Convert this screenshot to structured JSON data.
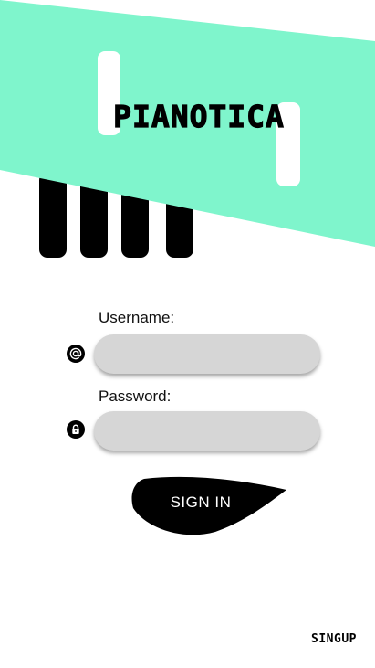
{
  "app": {
    "title": "PIANOTICA"
  },
  "colors": {
    "accent": "#7ff5cc",
    "keys": "#000000",
    "field": "#d6d6d6"
  },
  "form": {
    "username_label": "Username:",
    "username_value": "",
    "username_icon": "at-sign-icon",
    "password_label": "Password:",
    "password_value": "",
    "password_icon": "lock-icon",
    "signin_label": "SIGN IN"
  },
  "footer": {
    "signup_label": "SINGUP"
  }
}
